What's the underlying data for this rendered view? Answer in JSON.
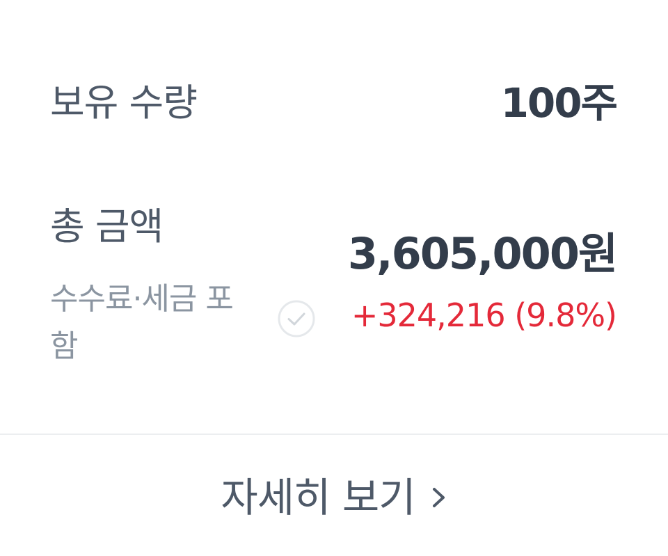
{
  "holdings": {
    "label": "보유 수량",
    "value": "100주"
  },
  "total": {
    "label": "총 금액",
    "fee_note": "수수료·세금 포함",
    "fee_included_checked": true,
    "amount": "3,605,000원",
    "profit": "+324,216 (9.8%)",
    "profit_color": "#e42939"
  },
  "detail_button": {
    "label": "자세히 보기",
    "icon": "chevron-right-icon"
  },
  "colors": {
    "primary_text": "#333d4b",
    "secondary_text": "#4e5968",
    "muted_text": "#8b95a1",
    "positive": "#e42939",
    "divider": "#eceef0"
  }
}
